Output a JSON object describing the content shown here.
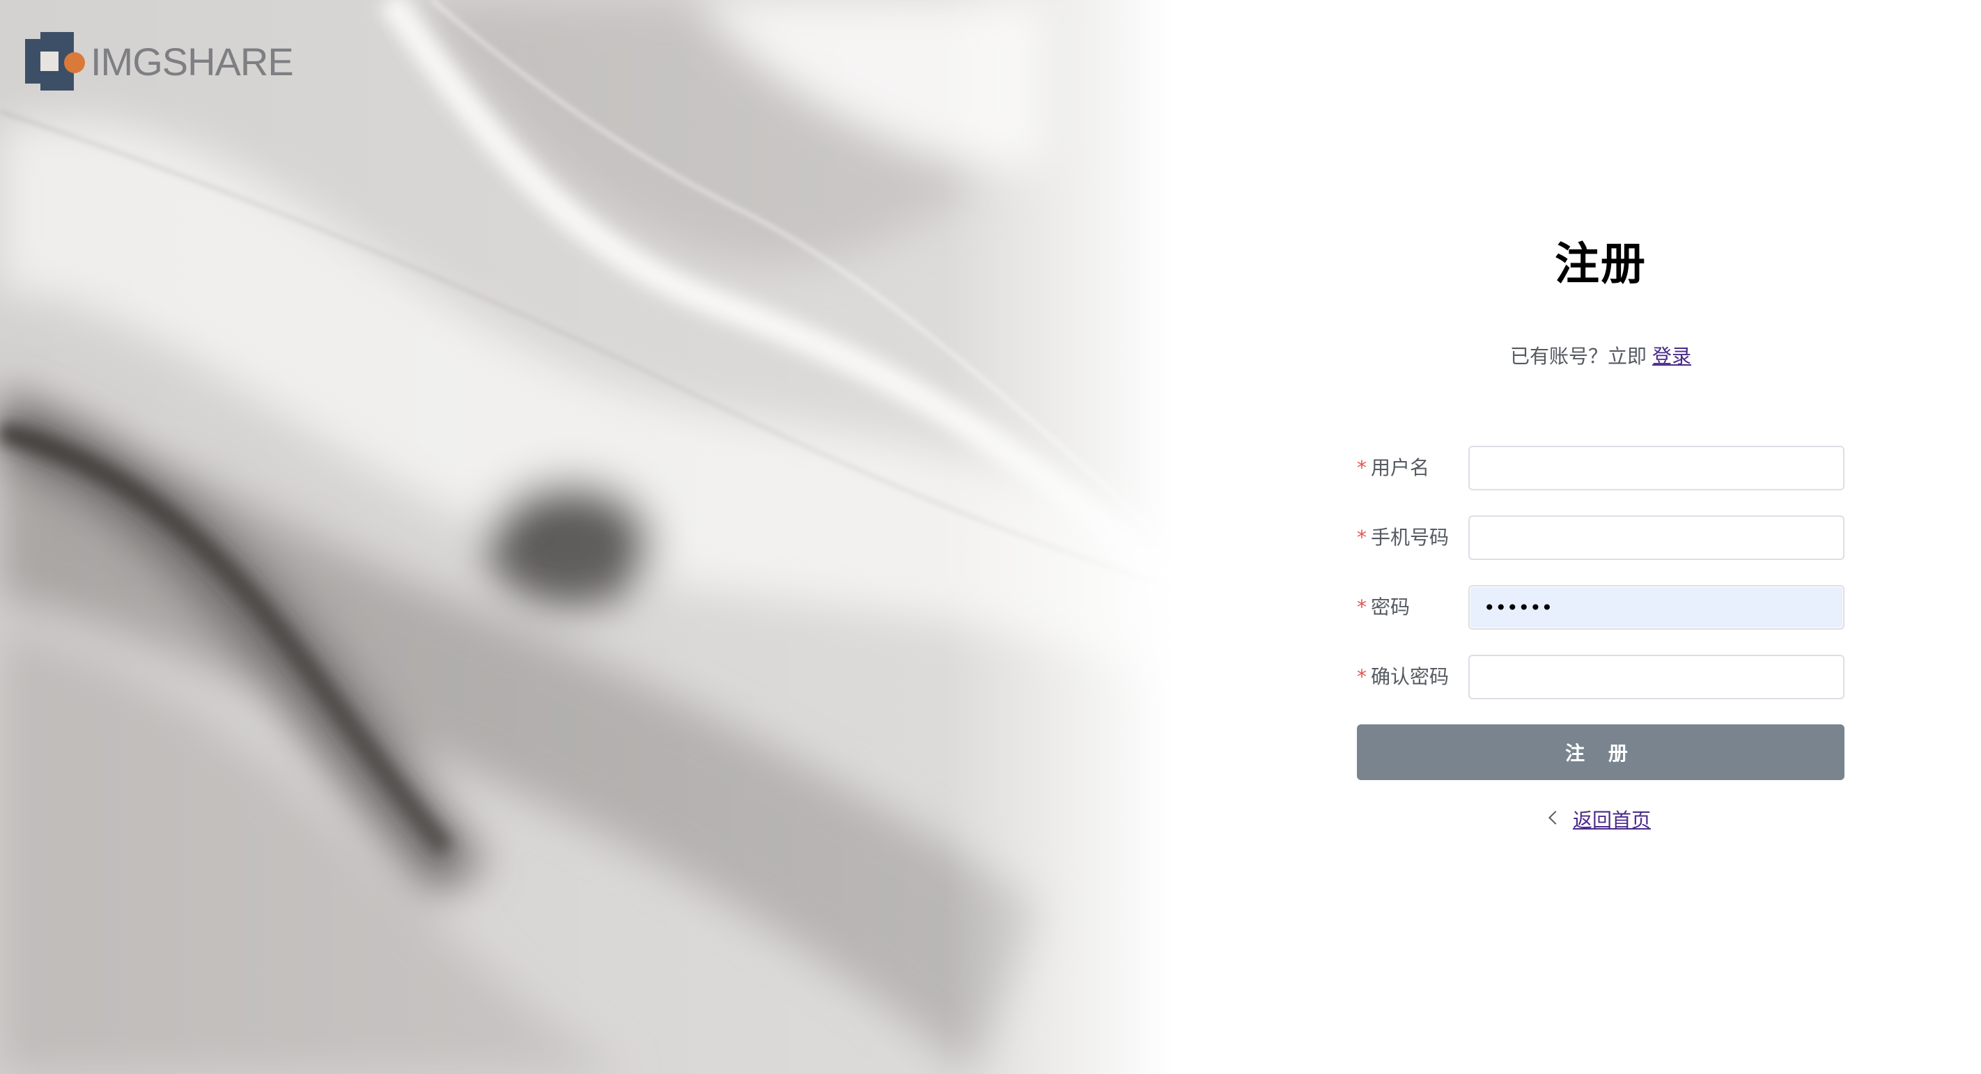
{
  "brand": {
    "name": "IMGSHARE",
    "colors": {
      "mark": "#3d4f66",
      "dot": "#d97a3a"
    }
  },
  "form": {
    "title": "注册",
    "login_prompt": "已有账号？立即",
    "login_link": "登录",
    "required_mark": "*",
    "fields": [
      {
        "label": "用户名",
        "value": "",
        "type": "text"
      },
      {
        "label": "手机号码",
        "value": "",
        "type": "text"
      },
      {
        "label": "密码",
        "value": "••••••",
        "type": "password"
      },
      {
        "label": "确认密码",
        "value": "",
        "type": "password"
      }
    ],
    "submit_label": "注 册",
    "back_home_label": "返回首页"
  },
  "colors": {
    "button": "#79848f",
    "link": "#4a2a8a",
    "required": "#e2554f",
    "autofill_bg": "#e8f0fe"
  }
}
